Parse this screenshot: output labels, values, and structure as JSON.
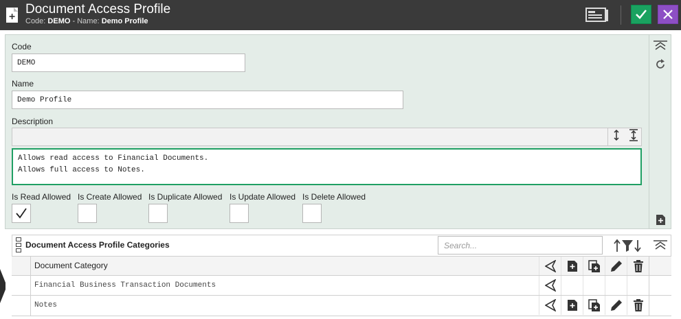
{
  "header": {
    "title": "Document Access Profile",
    "code_label": "Code:",
    "code_value": "DEMO",
    "separator": "-",
    "name_label": "Name:",
    "name_value": "Demo Profile"
  },
  "form": {
    "code_label": "Code",
    "code_value": "DEMO",
    "name_label": "Name",
    "name_value": "Demo Profile",
    "description_label": "Description",
    "description_lines": [
      "Allows read access to Financial Documents.",
      "Allows full access to Notes."
    ],
    "checkboxes": [
      {
        "label": "Is Read Allowed",
        "checked": true
      },
      {
        "label": "Is Create Allowed",
        "checked": false
      },
      {
        "label": "Is Duplicate Allowed",
        "checked": false
      },
      {
        "label": "Is Update Allowed",
        "checked": false
      },
      {
        "label": "Is Delete Allowed",
        "checked": false
      }
    ]
  },
  "grid": {
    "title": "Document Access Profile Categories",
    "search_placeholder": "Search...",
    "column_header": "Document Category",
    "rows": [
      {
        "category": "Financial Business Transaction Documents"
      },
      {
        "category": "Notes"
      }
    ]
  },
  "colors": {
    "titlebar": "#3a3a3a",
    "ok_button": "#1aa260",
    "cancel_button": "#8d4fc4",
    "form_background": "#e4ede8",
    "focus_border": "#1f9f63"
  }
}
